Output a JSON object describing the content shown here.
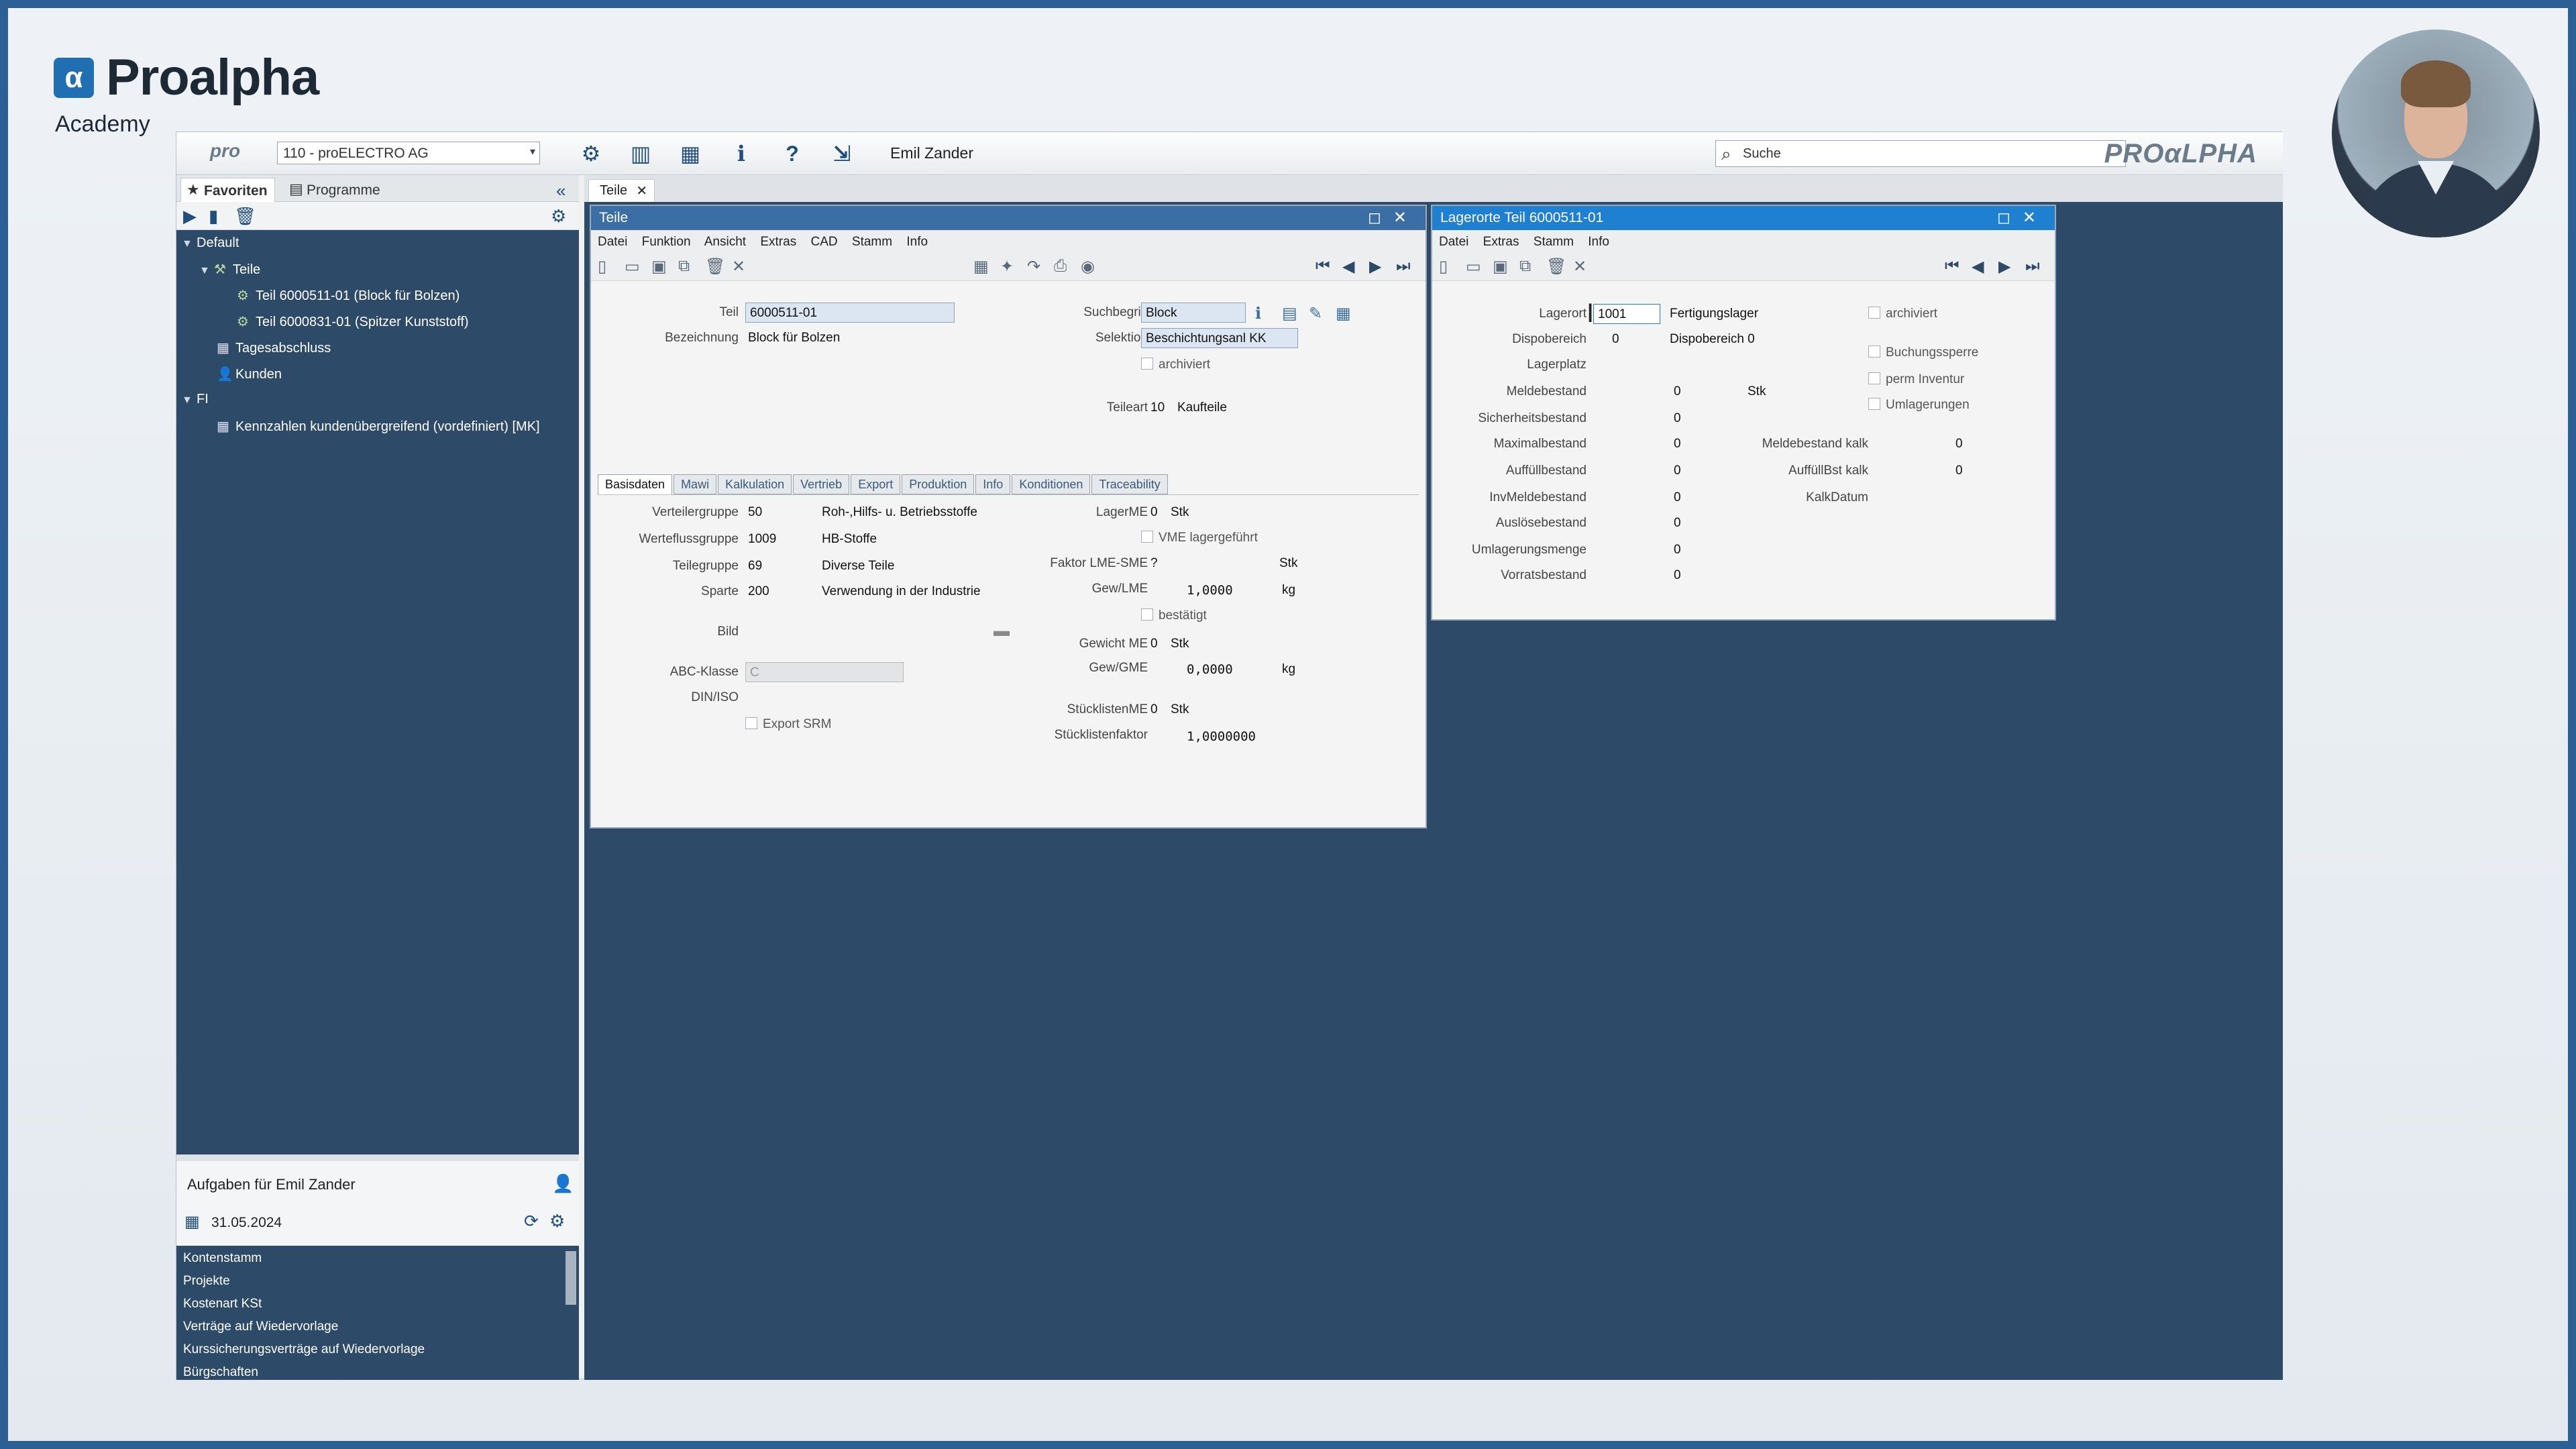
{
  "brand": {
    "logo_glyph": "α",
    "name": "Proalpha",
    "subtitle": "Academy",
    "app_brand": "PROαLPHA"
  },
  "topbar": {
    "pro_label": "pro",
    "company": "110 - proELECTRO AG",
    "user": "Emil Zander",
    "search_placeholder": "Suche"
  },
  "sidebar": {
    "tabs": [
      "Favoriten",
      "Programme"
    ],
    "tree": [
      {
        "label": "Default",
        "level": 0
      },
      {
        "label": "Teile",
        "level": 1
      },
      {
        "label": "Teil 6000511-01 (Block für Bolzen)",
        "level": 2
      },
      {
        "label": "Teil 6000831-01 (Spitzer Kunststoff)",
        "level": 2
      },
      {
        "label": "Tagesabschluss",
        "level": 1
      },
      {
        "label": "Kunden",
        "level": 1
      },
      {
        "label": "FI",
        "level": 0
      },
      {
        "label": "Kennzahlen kundenübergreifend (vordefiniert) [MK]",
        "level": 1
      }
    ]
  },
  "tasks": {
    "title": "Aufgaben für Emil Zander",
    "date": "31.05.2024",
    "items": [
      "Kontenstamm",
      "Projekte",
      "Kostenart KSt",
      "Verträge auf Wiedervorlage",
      "Kurssicherungsverträge auf Wiedervorlage",
      "Bürgschaften"
    ]
  },
  "doc_tab": "Teile",
  "teile": {
    "title": "Teile",
    "menu": [
      "Datei",
      "Funktion",
      "Ansicht",
      "Extras",
      "CAD",
      "Stamm",
      "Info"
    ],
    "teil_label": "Teil",
    "teil": "6000511-01",
    "bez_label": "Bezeichnung",
    "bez": "Block für Bolzen",
    "such_label": "Suchbegriff",
    "such": "Block",
    "sel_label": "Selektion",
    "sel": "Beschichtungsanl KK",
    "archiviert": "archiviert",
    "teileart_label": "Teileart",
    "teileart_code": "10",
    "teileart": "Kaufteile",
    "tabs": [
      "Basisdaten",
      "Mawi",
      "Kalkulation",
      "Vertrieb",
      "Export",
      "Produktion",
      "Info",
      "Konditionen",
      "Traceability"
    ],
    "left_fields": [
      {
        "label": "Verteilergruppe",
        "code": "50",
        "text": "Roh-,Hilfs- u. Betriebsstoffe"
      },
      {
        "label": "Werteflussgruppe",
        "code": "1009",
        "text": "HB-Stoffe"
      },
      {
        "label": "Teilegruppe",
        "code": "69",
        "text": "Diverse Teile"
      },
      {
        "label": "Sparte",
        "code": "200",
        "text": "Verwendung in der Industrie"
      }
    ],
    "bild_label": "Bild",
    "abc_label": "ABC-Klasse",
    "abc": "C",
    "din_label": "DIN/ISO",
    "export_srm": "Export SRM",
    "lagerme_label": "LagerME",
    "lagerme_code": "0",
    "lagerme": "Stk",
    "vme": "VME lagergeführt",
    "faktor_label": "Faktor LME-SME",
    "faktor": "?",
    "faktor_unit": "Stk",
    "gewlme_label": "Gew/LME",
    "gewlme": "1,0000",
    "gewlme_unit": "kg",
    "bestaetigt": "bestätigt",
    "gewme_label": "Gewicht ME",
    "gewme_code": "0",
    "gewme": "Stk",
    "gewgme_label": "Gew/GME",
    "gewgme": "0,0000",
    "gewgme_unit": "kg",
    "stueckme_label": "StücklistenME",
    "stueckme_code": "0",
    "stueckme": "Stk",
    "stueckfaktor_label": "Stücklistenfaktor",
    "stueckfaktor": "1,0000000"
  },
  "lager": {
    "title": "Lagerorte Teil 6000511-01",
    "menu": [
      "Datei",
      "Extras",
      "Stamm",
      "Info"
    ],
    "lagerort_label": "Lagerort",
    "lagerort": "1001",
    "lagerort_text": "Fertigungslager",
    "dispo_label": "Dispobereich",
    "dispo": "0",
    "dispo_text": "Dispobereich 0",
    "lagerplatz_label": "Lagerplatz",
    "fields": [
      {
        "label": "Meldebestand",
        "value": "0"
      },
      {
        "label": "Sicherheitsbestand",
        "value": "0"
      },
      {
        "label": "Maximalbestand",
        "value": "0"
      },
      {
        "label": "Auffüllbestand",
        "value": "0"
      },
      {
        "label": "InvMeldebestand",
        "value": "0"
      },
      {
        "label": "Auslösebestand",
        "value": "0"
      },
      {
        "label": "Umlagerungsmenge",
        "value": "0"
      },
      {
        "label": "Vorratsbestand",
        "value": "0"
      }
    ],
    "unit": "Stk",
    "meldekalk_label": "Meldebestand kalk",
    "meldekalk": "0",
    "auffkalk_label": "AuffüllBst kalk",
    "auffkalk": "0",
    "kalkdatum_label": "KalkDatum",
    "checks": [
      "archiviert",
      "Buchungssperre",
      "perm Inventur",
      "Umlagerungen"
    ]
  }
}
